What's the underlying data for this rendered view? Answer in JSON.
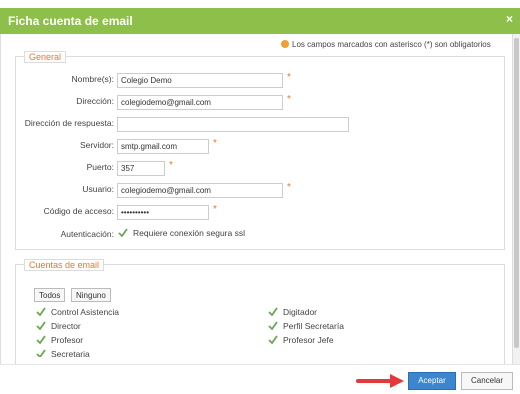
{
  "dialog": {
    "title": "Ficha cuenta de email",
    "close_glyph": "×",
    "required_notice": "Los campos marcados con asterisco (*) son obligatorios"
  },
  "general": {
    "legend": "General",
    "fields": {
      "nombre": {
        "label": "Nombre(s):",
        "value": "Colegio Demo"
      },
      "direccion": {
        "label": "Dirección:",
        "value": "colegiodemo@gmail.com"
      },
      "respuesta": {
        "label": "Dirección de respuesta:",
        "value": ""
      },
      "servidor": {
        "label": "Servidor:",
        "value": "smtp.gmail.com"
      },
      "puerto": {
        "label": "Puerto:",
        "value": "357"
      },
      "usuario": {
        "label": "Usuario:",
        "value": "colegiodemo@gmail.com"
      },
      "codigo": {
        "label": "Código de acceso:",
        "value": "••••••••••"
      },
      "autenticacion": {
        "label": "Autenticación:",
        "value": "Requiere conexión segura ssl"
      }
    },
    "required_mark": "*"
  },
  "cuentas": {
    "legend": "Cuentas de email",
    "todos": "Todos",
    "ninguno": "Ninguno",
    "items": [
      "Control Asistencia",
      "Digitador",
      "Director",
      "Perfil Secretaría",
      "Profesor",
      "Profesor Jefe",
      "Secretaria"
    ]
  },
  "footer": {
    "accept": "Aceptar",
    "cancel": "Cancelar"
  },
  "colors": {
    "title_bar": "#8dbf4a",
    "legend_accent": "#e8782a",
    "primary_button": "#3b86cf",
    "arrow": "#e5383b"
  }
}
